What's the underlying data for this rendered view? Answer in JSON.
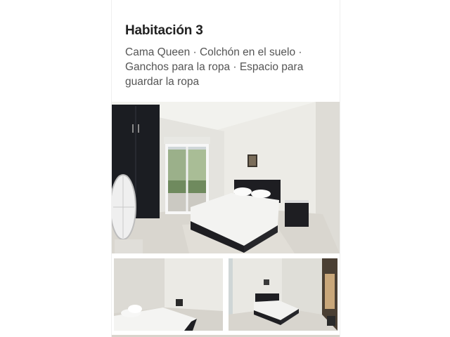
{
  "room": {
    "title": "Habitación 3",
    "amenities": "Cama Queen · Colchón en el suelo · Ganchos para la ropa · Espacio para guardar la ropa"
  },
  "colors": {
    "title_text": "#222222",
    "body_text": "#555555",
    "wardrobe": "#1b1d22",
    "bed_frame": "#1e1e22"
  }
}
